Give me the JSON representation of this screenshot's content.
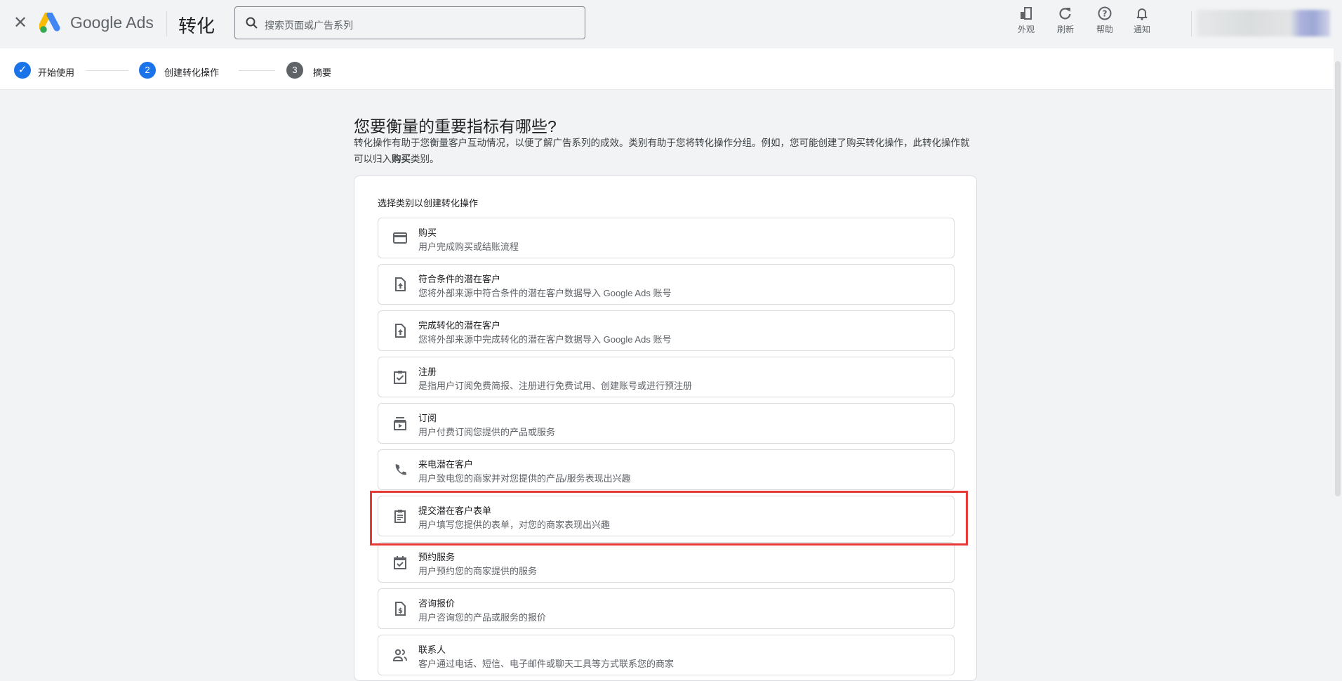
{
  "header": {
    "close_icon": "close-icon",
    "brand": "Google Ads",
    "title": "转化",
    "search_placeholder": "搜索页面或广告系列",
    "tools": [
      {
        "label": "外观",
        "icon": "appearance-icon"
      },
      {
        "label": "刷新",
        "icon": "refresh-icon"
      },
      {
        "label": "帮助",
        "icon": "help-icon"
      },
      {
        "label": "通知",
        "icon": "bell-icon"
      }
    ]
  },
  "stepper": {
    "steps": [
      {
        "num": "✓",
        "label": "开始使用"
      },
      {
        "num": "2",
        "label": "创建转化操作"
      },
      {
        "num": "3",
        "label": "摘要"
      }
    ]
  },
  "main": {
    "heading": "您要衡量的重要指标有哪些?",
    "desc_a": "转化操作有助于您衡量客户互动情况，以便了解广告系列的成效。类别有助于您将转化操作分组。例如，您可能创建了购买转化操作，此转化操作就可以归入",
    "desc_bold": "购买",
    "desc_b": "类别。"
  },
  "card": {
    "label": "选择类别以创建转化操作",
    "items": [
      {
        "title": "购买",
        "desc": "用户完成购买或结账流程",
        "icon": "credit-card-icon"
      },
      {
        "title": "符合条件的潜在客户",
        "desc": "您将外部来源中符合条件的潜在客户数据导入 Google Ads 账号",
        "icon": "file-upload-icon"
      },
      {
        "title": "完成转化的潜在客户",
        "desc": "您将外部来源中完成转化的潜在客户数据导入 Google Ads 账号",
        "icon": "file-upload-icon"
      },
      {
        "title": "注册",
        "desc": "是指用户订阅免费简报、注册进行免费试用、创建账号或进行预注册",
        "icon": "clipboard-check-icon"
      },
      {
        "title": "订阅",
        "desc": "用户付费订阅您提供的产品或服务",
        "icon": "subscriptions-icon"
      },
      {
        "title": "来电潜在客户",
        "desc": "用户致电您的商家并对您提供的产品/服务表现出兴趣",
        "icon": "phone-icon"
      },
      {
        "title": "提交潜在客户表单",
        "desc": "用户填写您提供的表单，对您的商家表现出兴趣",
        "icon": "form-icon"
      },
      {
        "title": "预约服务",
        "desc": "用户预约您的商家提供的服务",
        "icon": "calendar-check-icon"
      },
      {
        "title": "咨询报价",
        "desc": "用户咨询您的产品或服务的报价",
        "icon": "quote-icon"
      },
      {
        "title": "联系人",
        "desc": "客户通过电话、短信、电子邮件或聊天工具等方式联系您的商家",
        "icon": "contacts-icon"
      }
    ]
  },
  "colors": {
    "accent": "#1a73e8",
    "highlight": "#e53935"
  }
}
